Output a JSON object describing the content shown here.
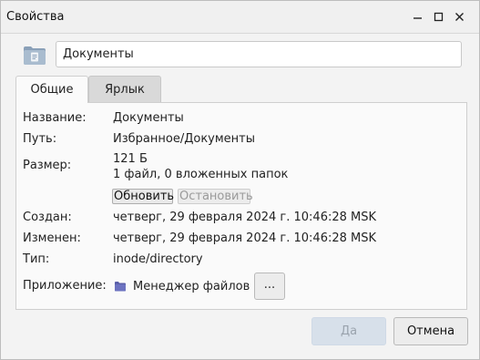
{
  "window": {
    "title": "Свойства",
    "icons": {
      "minimize": "minimize-icon",
      "maximize": "maximize-icon",
      "close": "close-icon"
    }
  },
  "header": {
    "icon": "folder-document-icon",
    "name_value": "Документы"
  },
  "tabs": [
    {
      "label": "Общие",
      "active": true
    },
    {
      "label": "Ярлык",
      "active": false
    }
  ],
  "general": {
    "name_label": "Название:",
    "name_value": "Документы",
    "path_label": "Путь:",
    "path_value": "Избранное/Документы",
    "size_label": "Размер:",
    "size_value": "121 Б",
    "size_detail": "1 файл, 0 вложенных папок",
    "refresh_button": "Обновить",
    "stop_button": "Остановить",
    "created_label": "Создан:",
    "created_value": "четверг, 29 февраля 2024 г. 10:46:28 MSK",
    "modified_label": "Изменен:",
    "modified_value": "четверг, 29 февраля 2024 г. 10:46:28 MSK",
    "type_label": "Тип:",
    "type_value": "inode/directory",
    "app_label": "Приложение:",
    "app_icon": "file-manager-icon",
    "app_value": "Менеджер файлов",
    "app_more_button": "..."
  },
  "footer": {
    "ok_button": "Да",
    "cancel_button": "Отмена"
  },
  "colors": {
    "background": "#f3f3f3",
    "panel": "#fafafa",
    "disabled_primary": "#d7e0ea",
    "app_icon": "#5a5fa8"
  }
}
